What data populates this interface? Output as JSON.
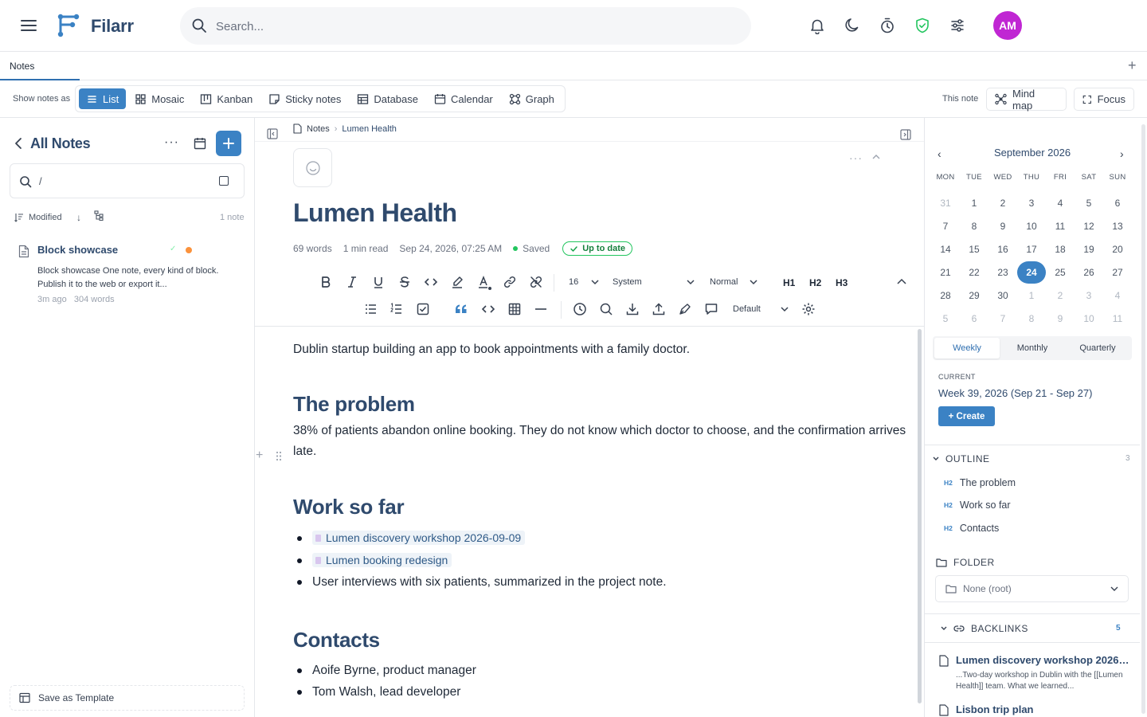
{
  "app": {
    "name": "Filarr",
    "search_placeholder": "Search...",
    "avatar_initials": "AM",
    "accent": "#3b82c4",
    "title_color": "#2f4a6d",
    "avatar_color": "#c026d3"
  },
  "tabs": [
    {
      "label": "Notes"
    }
  ],
  "viewbar": {
    "label": "Show notes as",
    "views": [
      {
        "label": "List",
        "icon": "list-icon",
        "active": true
      },
      {
        "label": "Mosaic",
        "icon": "grid-icon"
      },
      {
        "label": "Kanban",
        "icon": "kanban-icon"
      },
      {
        "label": "Sticky notes",
        "icon": "sticky-note-icon"
      },
      {
        "label": "Database",
        "icon": "table-icon"
      },
      {
        "label": "Calendar",
        "icon": "calendar-icon"
      },
      {
        "label": "Graph",
        "icon": "graph-icon"
      }
    ],
    "this_note_label": "This note",
    "mind_map_label": "Mind map",
    "focus_label": "Focus"
  },
  "left": {
    "title": "All Notes",
    "search_value": "/",
    "sort_label": "Modified",
    "count_label": "1 note",
    "notes": [
      {
        "title": "Block showcase",
        "snippet": "Block showcase One note, every kind of block. Publish it to the web or export it...",
        "time": "3m ago",
        "words": "304 words"
      }
    ],
    "save_template_label": "Save as Template"
  },
  "note": {
    "breadcrumb": [
      "Notes",
      "Lumen Health"
    ],
    "title": "Lumen Health",
    "words": "69 words",
    "read_time": "1 min read",
    "date": "Sep 24, 2026, 07:25 AM",
    "saved_label": "Saved",
    "status_label": "Up to date",
    "toolbar": {
      "font_size": "16",
      "font_family": "System",
      "paragraph_style": "Normal",
      "h1": "H1",
      "h2": "H2",
      "h3": "H3",
      "theme": "Default"
    },
    "intro": "Dublin startup building an app to book appointments with a family doctor.",
    "sections": [
      {
        "heading": "The problem",
        "text": "38% of patients abandon online booking. They do not know which doctor to choose, and the confirmation arrives late."
      },
      {
        "heading": "Work so far",
        "links": [
          "Lumen discovery workshop 2026-09-09",
          "Lumen booking redesign"
        ],
        "text": "User interviews with six patients, summarized in the project note."
      },
      {
        "heading": "Contacts",
        "items": [
          "Aoife Byrne, product manager",
          "Tom Walsh, lead developer"
        ]
      }
    ]
  },
  "right": {
    "calendar": {
      "title": "September 2026",
      "dow": [
        "MON",
        "TUE",
        "WED",
        "THU",
        "FRI",
        "SAT",
        "SUN"
      ],
      "weeks": [
        [
          "31",
          "1",
          "2",
          "3",
          "4",
          "5",
          "6"
        ],
        [
          "7",
          "8",
          "9",
          "10",
          "11",
          "12",
          "13"
        ],
        [
          "14",
          "15",
          "16",
          "17",
          "18",
          "19",
          "20"
        ],
        [
          "21",
          "22",
          "23",
          "24",
          "25",
          "26",
          "27"
        ],
        [
          "28",
          "29",
          "30",
          "1",
          "2",
          "3",
          "4"
        ],
        [
          "5",
          "6",
          "7",
          "8",
          "9",
          "10",
          "11"
        ]
      ],
      "today": "24"
    },
    "periods": [
      "Weekly",
      "Monthly",
      "Quarterly"
    ],
    "current_label": "CURRENT",
    "current_week": "Week 39, 2026 (Sep 21 - Sep 27)",
    "create_label": "+ Create",
    "outline_label": "OUTLINE",
    "outline_count": "3",
    "outline": [
      {
        "tag": "H2",
        "text": "The problem"
      },
      {
        "tag": "H2",
        "text": "Work so far"
      },
      {
        "tag": "H2",
        "text": "Contacts"
      }
    ],
    "folder_label": "FOLDER",
    "folder_value": "None (root)",
    "backlinks_label": "BACKLINKS",
    "backlinks_count": "5",
    "backlinks": [
      {
        "title": "Lumen discovery workshop 2026-...",
        "snippet": "...Two-day workshop in Dublin with the [[Lumen Health]] team. What we learned..."
      },
      {
        "title": "Lisbon trip plan",
        "snippet": ""
      }
    ]
  }
}
